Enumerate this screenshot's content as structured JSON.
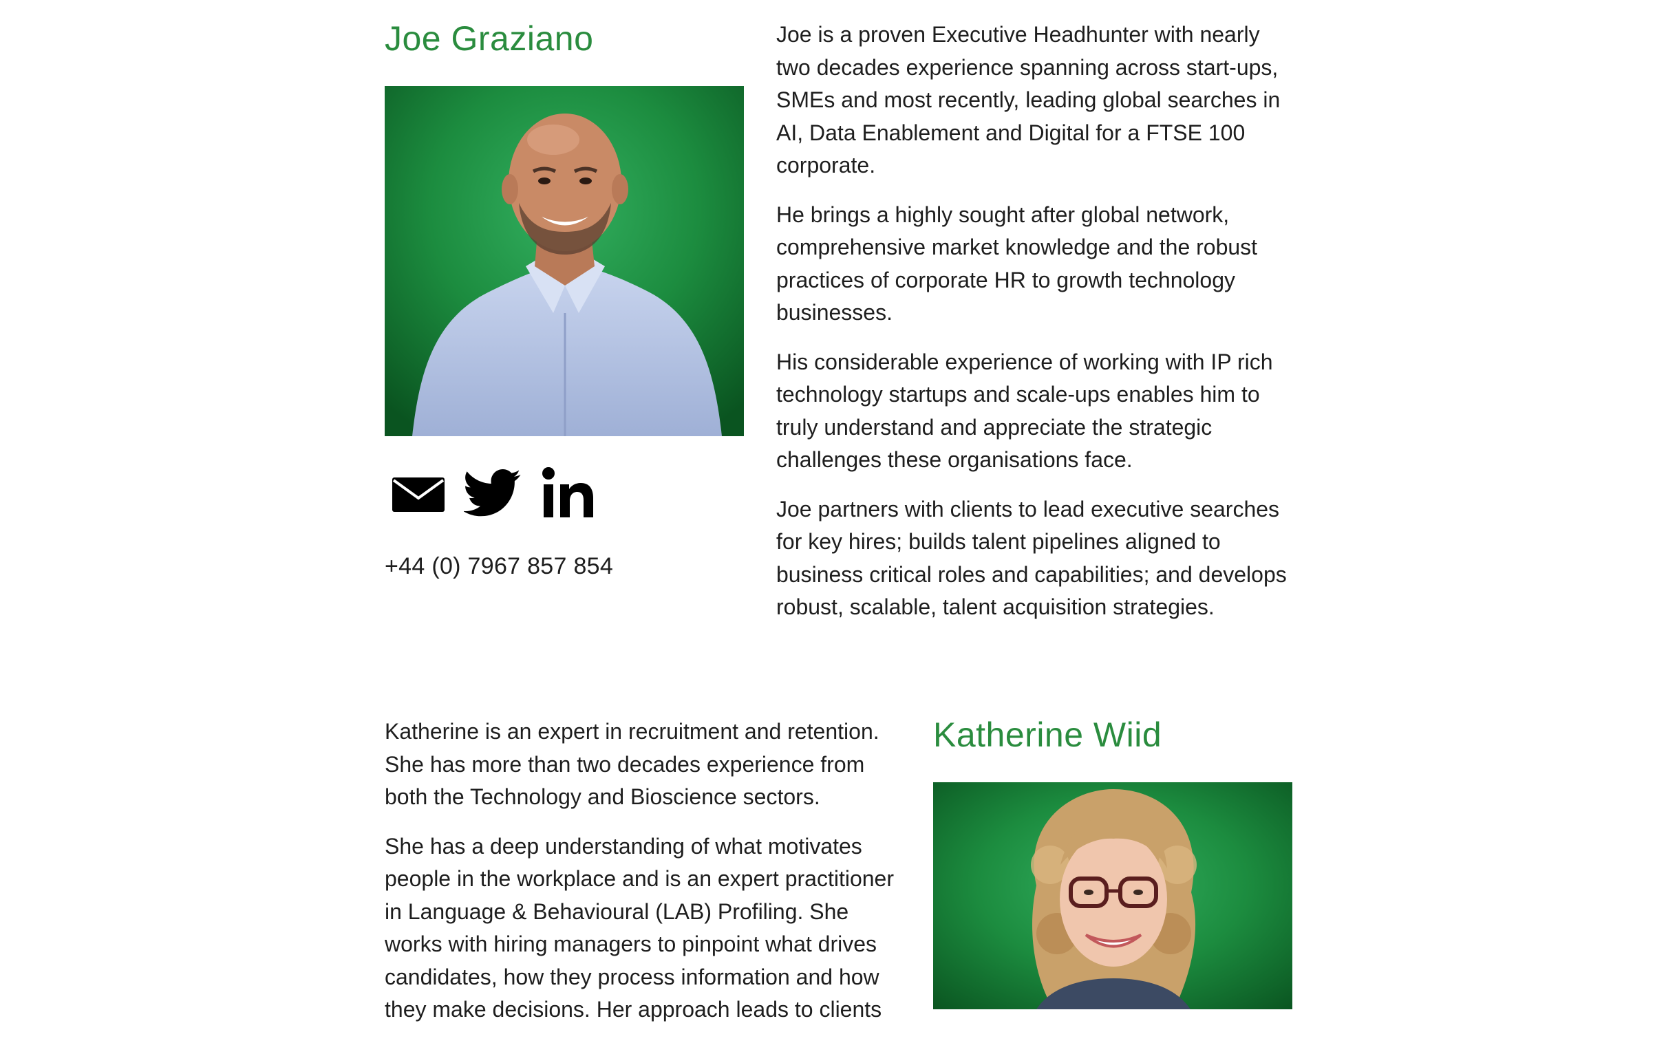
{
  "profiles": [
    {
      "name": "Joe Graziano",
      "photo_alt": "Photo of Joe Graziano",
      "social_icons": [
        "email-icon",
        "twitter-icon",
        "linkedin-icon"
      ],
      "phone": "+44 (0) 7967 857 854",
      "bio": [
        "Joe is a proven Executive Headhunter with nearly two decades experience spanning across start-ups, SMEs and most recently, leading global searches in AI, Data Enablement and Digital for a FTSE 100 corporate.",
        "He brings a highly sought after global network, comprehensive market knowledge and the robust practices of corporate HR to growth technology businesses.",
        "His considerable experience of working with IP rich technology startups and scale-ups enables him to truly understand and appreciate the strategic challenges these organisations face.",
        "Joe partners with clients to lead executive searches for key hires; builds talent pipelines aligned to business critical roles and capabilities; and develops robust, scalable, talent acquisition strategies."
      ]
    },
    {
      "name": "Katherine Wiid",
      "photo_alt": "Photo of Katherine Wiid",
      "bio": [
        "Katherine is an expert in recruitment and retention. She has more than two decades experience from both the Technology and Bioscience sectors.",
        "She has a deep understanding of what motivates people in the workplace and is an expert practitioner in Language & Behavioural (LAB) Profiling. She works with hiring managers to pinpoint what drives candidates, how they process information and how they make decisions. Her approach leads to clients"
      ]
    }
  ],
  "colors": {
    "name_green": "#2a8c3e",
    "photo_bg_green": "#1c8c3f",
    "text": "#1e1e1e"
  }
}
